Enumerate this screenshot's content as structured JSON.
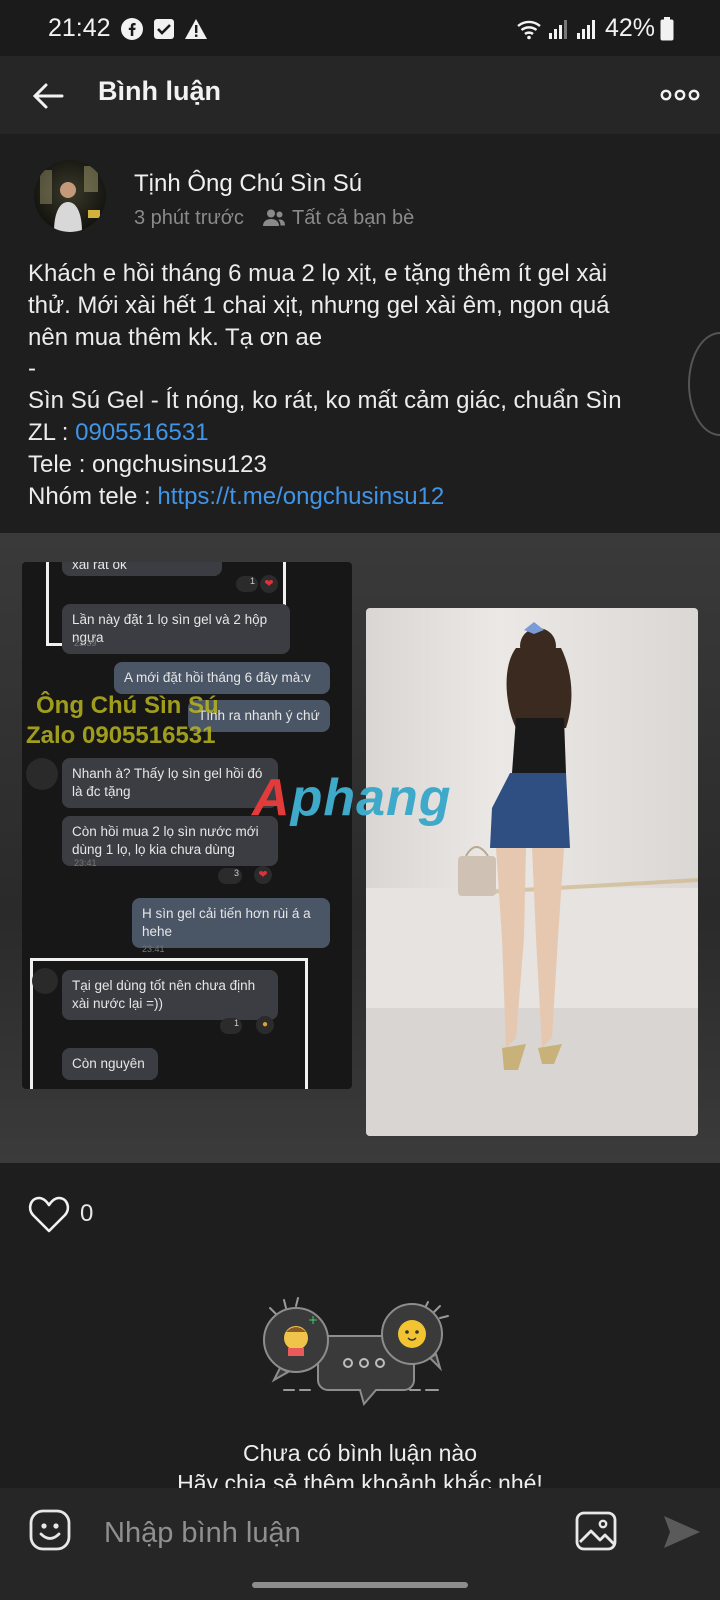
{
  "status_bar": {
    "time": "21:42",
    "battery": "42%",
    "icons": [
      "facebook-icon",
      "checkbox-icon",
      "warning-icon",
      "wifi-icon",
      "signal-icon",
      "signal-icon",
      "battery-icon"
    ]
  },
  "app_bar": {
    "title": "Bình luận",
    "back_icon": "back-arrow-icon",
    "more_icon": "more-icon"
  },
  "post": {
    "author": "Tịnh Ông Chú Sìn Sú",
    "time_ago": "3 phút trước",
    "audience": "Tất cả bạn bè",
    "text_lines": [
      "Khách e hồi tháng 6 mua 2 lọ xịt, e tặng thêm ít gel xài",
      "thử. Mới xài hết 1 chai xịt, nhưng gel xài êm, ngon quá",
      "nên mua thêm kk. Tạ ơn ae",
      "-",
      "Sìn Sú Gel - Ít nóng, ko rát, ko mất cảm giác, chuẩn Sìn"
    ],
    "zl_label": "ZL : ",
    "zl_phone": "0905516531",
    "tele_line": "Tele : ongchusinsu123",
    "group_label": "Nhóm tele : ",
    "group_link": "https://t.me/ongchusinsu12",
    "likes": "0"
  },
  "chat_screenshot": {
    "messages": [
      {
        "text": "xài rất ok",
        "mine": false
      },
      {
        "text": "Lần này đặt 1 lọ sìn gel và 2 hộp ngựa",
        "mine": false,
        "time": "23:39"
      },
      {
        "text": "A mới đặt hồi tháng 6 đây mà:v",
        "mine": true
      },
      {
        "text": "Tính ra nhanh ý chứ",
        "mine": true
      },
      {
        "text": "Nhanh à? Thấy lọ sìn gel hồi đó là đc tặng",
        "mine": false
      },
      {
        "text": "Còn hồi mua 2 lọ sìn nước mới dùng 1 lọ, lọ kia chưa dùng",
        "mine": false,
        "time": "23:41"
      },
      {
        "text": "H sìn gel cải tiến hơn rùi á a hehe",
        "mine": true,
        "time": "23:41"
      },
      {
        "text": "Tại gel dùng tốt nên chưa định xài nước lại =))",
        "mine": false
      },
      {
        "text": "Còn nguyên",
        "mine": false
      }
    ],
    "reaction_counts": [
      "1",
      "3",
      "1"
    ],
    "watermark_line1": "Ông Chú Sìn Sú",
    "watermark_line2": "Zalo 0905516531"
  },
  "photo_watermark": "Aphang",
  "empty_state": {
    "line1": "Chưa có bình luận nào",
    "line2": "Hãy chia sẻ thêm khoảnh khắc nhé!"
  },
  "composer": {
    "placeholder": "Nhập bình luận"
  },
  "colors": {
    "background": "#1e1e1f",
    "bar": "#262627",
    "link": "#3f95e8"
  }
}
